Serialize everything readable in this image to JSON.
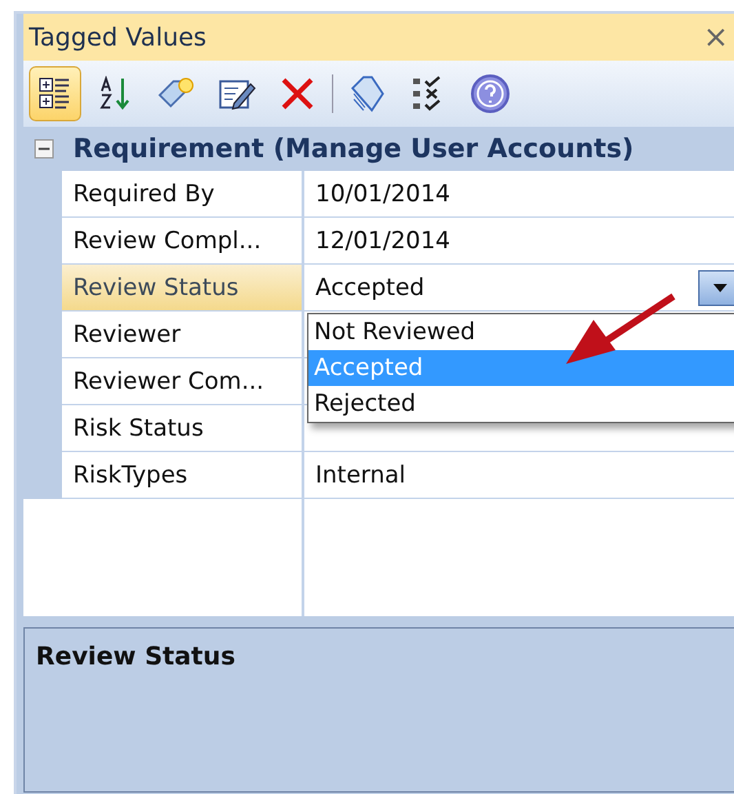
{
  "window": {
    "title": "Tagged Values",
    "close": "×"
  },
  "toolbar": {
    "categorized_on": true,
    "buttons": [
      {
        "kind": "categorized"
      },
      {
        "kind": "sort"
      },
      {
        "kind": "new-tag"
      },
      {
        "kind": "edit"
      },
      {
        "kind": "delete"
      },
      {
        "kind": "separator"
      },
      {
        "kind": "tags"
      },
      {
        "kind": "checklist"
      },
      {
        "kind": "help"
      }
    ]
  },
  "group": {
    "title": "Requirement (Manage User Accounts)",
    "expanded": true
  },
  "rows": [
    {
      "label": "Required By",
      "value": "10/01/2014",
      "selected": false
    },
    {
      "label": "Review Compl...",
      "value": "12/01/2014",
      "selected": false
    },
    {
      "label": "Review Status",
      "value": "Accepted",
      "selected": true
    },
    {
      "label": "Reviewer",
      "selected": false
    },
    {
      "label": "Reviewer Com...",
      "selected": false
    },
    {
      "label": "Risk Status",
      "selected": false
    },
    {
      "label": "RiskTypes",
      "value": "Internal",
      "selected": false
    }
  ],
  "dropdown": {
    "options": [
      {
        "label": "Not Reviewed",
        "selected": false
      },
      {
        "label": "Accepted",
        "selected": true
      },
      {
        "label": "Rejected",
        "selected": false
      }
    ]
  },
  "description": {
    "title": "Review Status"
  }
}
